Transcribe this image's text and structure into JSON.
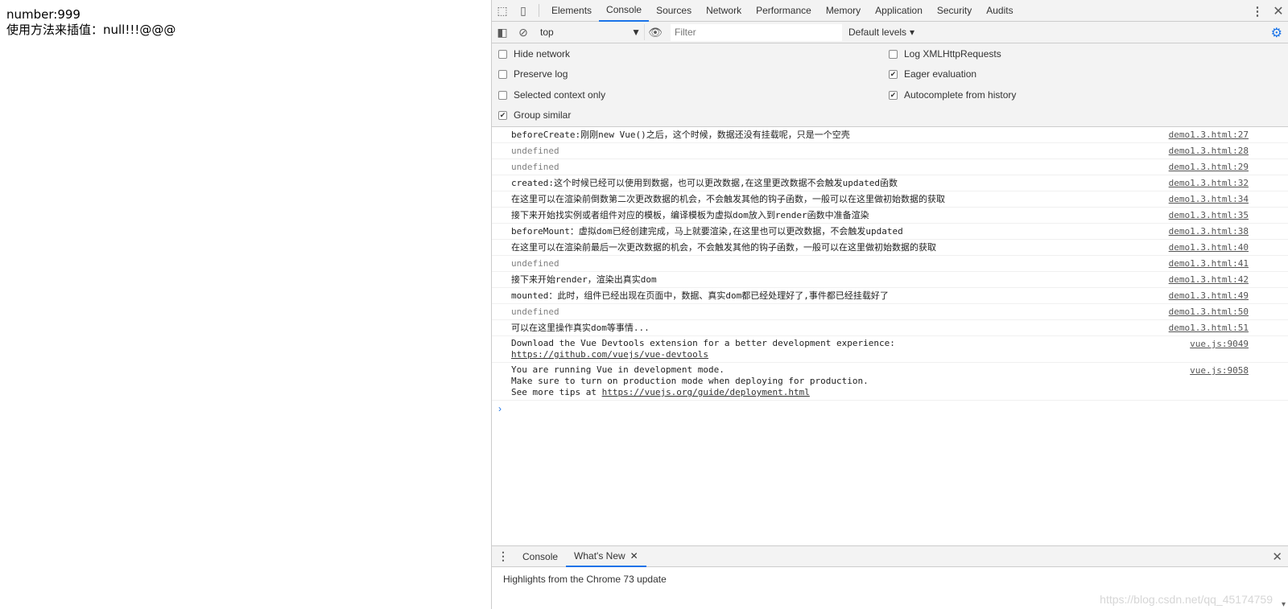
{
  "page": {
    "line1": "number:999",
    "line2": "使用方法来插值：null!!!@@@"
  },
  "devtools": {
    "tabs": [
      "Elements",
      "Console",
      "Sources",
      "Network",
      "Performance",
      "Memory",
      "Application",
      "Security",
      "Audits"
    ],
    "active_tab": "Console",
    "toolbar": {
      "context": "top",
      "filter_placeholder": "Filter",
      "levels": "Default levels"
    },
    "settings": {
      "hide_network": {
        "label": "Hide network",
        "checked": false
      },
      "preserve_log": {
        "label": "Preserve log",
        "checked": false
      },
      "selected_context_only": {
        "label": "Selected context only",
        "checked": false
      },
      "group_similar": {
        "label": "Group similar",
        "checked": true
      },
      "log_xhr": {
        "label": "Log XMLHttpRequests",
        "checked": false
      },
      "eager_evaluation": {
        "label": "Eager evaluation",
        "checked": true
      },
      "autocomplete_history": {
        "label": "Autocomplete from history",
        "checked": true
      }
    },
    "messages": [
      {
        "text": "beforeCreate:刚刚new Vue()之后，这个时候，数据还没有挂载呢，只是一个空壳",
        "src": "demo1.3.html:27",
        "gray": false
      },
      {
        "text": "undefined",
        "src": "demo1.3.html:28",
        "gray": true
      },
      {
        "text": "undefined",
        "src": "demo1.3.html:29",
        "gray": true
      },
      {
        "text": "created:这个时候已经可以使用到数据，也可以更改数据,在这里更改数据不会触发updated函数",
        "src": "demo1.3.html:32",
        "gray": false
      },
      {
        "text": "在这里可以在渲染前倒数第二次更改数据的机会，不会触发其他的钩子函数，一般可以在这里做初始数据的获取",
        "src": "demo1.3.html:34",
        "gray": false
      },
      {
        "text": "接下来开始找实例或者组件对应的模板，编译模板为虚拟dom放入到render函数中准备渲染",
        "src": "demo1.3.html:35",
        "gray": false
      },
      {
        "text": "beforeMount：虚拟dom已经创建完成，马上就要渲染,在这里也可以更改数据，不会触发updated",
        "src": "demo1.3.html:38",
        "gray": false
      },
      {
        "text": "在这里可以在渲染前最后一次更改数据的机会，不会触发其他的钩子函数，一般可以在这里做初始数据的获取",
        "src": "demo1.3.html:40",
        "gray": false
      },
      {
        "text": "undefined",
        "src": "demo1.3.html:41",
        "gray": true
      },
      {
        "text": "接下来开始render，渲染出真实dom",
        "src": "demo1.3.html:42",
        "gray": false
      },
      {
        "text": "mounted：此时，组件已经出现在页面中，数据、真实dom都已经处理好了,事件都已经挂载好了",
        "src": "demo1.3.html:49",
        "gray": false
      },
      {
        "text": "undefined",
        "src": "demo1.3.html:50",
        "gray": true
      },
      {
        "text": "可以在这里操作真实dom等事情...",
        "src": "demo1.3.html:51",
        "gray": false
      }
    ],
    "devtools_msg": {
      "line1": "Download the Vue Devtools extension for a better development experience:",
      "link": "https://github.com/vuejs/vue-devtools",
      "src": "vue.js:9049"
    },
    "devmode_msg": {
      "line1": "You are running Vue in development mode.",
      "line2": "Make sure to turn on production mode when deploying for production.",
      "line3_prefix": "See more tips at ",
      "link": "https://vuejs.org/guide/deployment.html",
      "src": "vue.js:9058"
    },
    "drawer": {
      "tabs": [
        "Console",
        "What's New"
      ],
      "active": "What's New",
      "body": "Highlights from the Chrome 73 update"
    },
    "watermark": "https://blog.csdn.net/qq_45174759"
  }
}
